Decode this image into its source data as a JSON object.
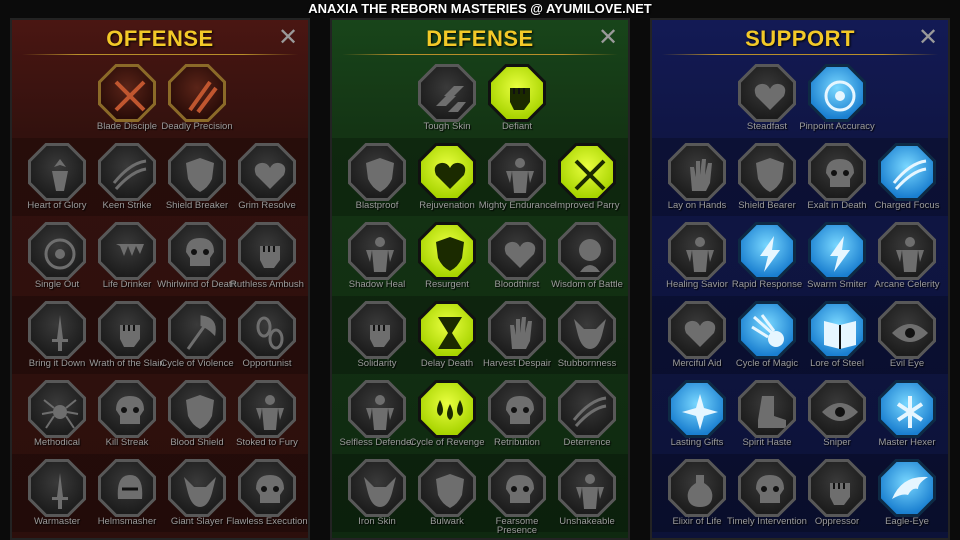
{
  "banner": "ANAXIA THE REBORN MASTERIES @ AYUMILOVE.NET",
  "close_glyph": "✕",
  "panels": [
    {
      "title": "OFFENSE",
      "tier1": [
        {
          "label": "Blade Disciple",
          "icon": "crossed-blades-icon",
          "active": true
        },
        {
          "label": "Deadly Precision",
          "icon": "daggers-icon",
          "active": true
        }
      ],
      "rows": [
        [
          {
            "label": "Heart of Glory",
            "icon": "warrior-icon",
            "active": false
          },
          {
            "label": "Keen Strike",
            "icon": "slash-icon",
            "active": false
          },
          {
            "label": "Shield Breaker",
            "icon": "shield-icon",
            "active": false
          },
          {
            "label": "Grim Resolve",
            "icon": "heart-icon",
            "active": false
          }
        ],
        [
          {
            "label": "Single Out",
            "icon": "target-icon",
            "active": false
          },
          {
            "label": "Life Drinker",
            "icon": "fangs-icon",
            "active": false
          },
          {
            "label": "Whirlwind of Death",
            "icon": "skull-icon",
            "active": false
          },
          {
            "label": "Ruthless Ambush",
            "icon": "fist-icon",
            "active": false
          }
        ],
        [
          {
            "label": "Bring it Down",
            "icon": "sword-icon",
            "active": false
          },
          {
            "label": "Wrath of the Slain",
            "icon": "fist-icon",
            "active": false
          },
          {
            "label": "Cycle of Violence",
            "icon": "axe-icon",
            "active": false
          },
          {
            "label": "Opportunist",
            "icon": "chain-icon",
            "active": false
          }
        ],
        [
          {
            "label": "Methodical",
            "icon": "spider-icon",
            "active": false
          },
          {
            "label": "Kill Streak",
            "icon": "skull-icon",
            "active": false
          },
          {
            "label": "Blood Shield",
            "icon": "shield-icon",
            "active": false
          },
          {
            "label": "Stoked to Fury",
            "icon": "figure-icon",
            "active": false
          }
        ],
        [
          {
            "label": "Warmaster",
            "icon": "sword-icon",
            "active": false
          },
          {
            "label": "Helmsmasher",
            "icon": "helmet-icon",
            "active": false
          },
          {
            "label": "Giant Slayer",
            "icon": "beast-icon",
            "active": false
          },
          {
            "label": "Flawless Execution",
            "icon": "skull-icon",
            "active": false
          }
        ]
      ]
    },
    {
      "title": "DEFENSE",
      "tier1": [
        {
          "label": "Tough Skin",
          "icon": "scales-icon",
          "active": false
        },
        {
          "label": "Defiant",
          "icon": "fist-icon",
          "active": true
        }
      ],
      "rows": [
        [
          {
            "label": "Blastproof",
            "icon": "shield-icon",
            "active": false
          },
          {
            "label": "Rejuvenation",
            "icon": "heart-icon",
            "active": true
          },
          {
            "label": "Mighty Endurance",
            "icon": "figure-icon",
            "active": false
          },
          {
            "label": "Improved Parry",
            "icon": "crossed-blades-icon",
            "active": true
          }
        ],
        [
          {
            "label": "Shadow Heal",
            "icon": "figure-icon",
            "active": false
          },
          {
            "label": "Resurgent",
            "icon": "shield-icon",
            "active": true
          },
          {
            "label": "Bloodthirst",
            "icon": "heart-icon",
            "active": false
          },
          {
            "label": "Wisdom of Battle",
            "icon": "head-icon",
            "active": false
          }
        ],
        [
          {
            "label": "Solidarity",
            "icon": "fist-icon",
            "active": false
          },
          {
            "label": "Delay Death",
            "icon": "hourglass-icon",
            "active": true
          },
          {
            "label": "Harvest Despair",
            "icon": "hand-icon",
            "active": false
          },
          {
            "label": "Stubbornness",
            "icon": "beast-icon",
            "active": false
          }
        ],
        [
          {
            "label": "Selfless Defender",
            "icon": "figure-icon",
            "active": false
          },
          {
            "label": "Cycle of Revenge",
            "icon": "drops-icon",
            "active": true
          },
          {
            "label": "Retribution",
            "icon": "skull-icon",
            "active": false
          },
          {
            "label": "Deterrence",
            "icon": "slash-icon",
            "active": false
          }
        ],
        [
          {
            "label": "Iron Skin",
            "icon": "beast-icon",
            "active": false
          },
          {
            "label": "Bulwark",
            "icon": "shield-icon",
            "active": false
          },
          {
            "label": "Fearsome Presence",
            "icon": "skull-icon",
            "active": false
          },
          {
            "label": "Unshakeable",
            "icon": "figure-icon",
            "active": false
          }
        ]
      ]
    },
    {
      "title": "SUPPORT",
      "tier1": [
        {
          "label": "Steadfast",
          "icon": "heart-icon",
          "active": false
        },
        {
          "label": "Pinpoint Accuracy",
          "icon": "target-icon",
          "active": true
        }
      ],
      "rows": [
        [
          {
            "label": "Lay on Hands",
            "icon": "hand-icon",
            "active": false
          },
          {
            "label": "Shield Bearer",
            "icon": "shield-icon",
            "active": false
          },
          {
            "label": "Exalt in Death",
            "icon": "skull-icon",
            "active": false
          },
          {
            "label": "Charged Focus",
            "icon": "slash-icon",
            "active": true
          }
        ],
        [
          {
            "label": "Healing Savior",
            "icon": "figure-icon",
            "active": false
          },
          {
            "label": "Rapid Response",
            "icon": "lightning-icon",
            "active": true
          },
          {
            "label": "Swarm Smiter",
            "icon": "lightning-icon",
            "active": true
          },
          {
            "label": "Arcane Celerity",
            "icon": "figure-icon",
            "active": false
          }
        ],
        [
          {
            "label": "Merciful Aid",
            "icon": "heart-icon",
            "active": false
          },
          {
            "label": "Cycle of Magic",
            "icon": "comet-icon",
            "active": true
          },
          {
            "label": "Lore of Steel",
            "icon": "book-icon",
            "active": true
          },
          {
            "label": "Evil Eye",
            "icon": "eye-icon",
            "active": false
          }
        ],
        [
          {
            "label": "Lasting Gifts",
            "icon": "star-icon",
            "active": true
          },
          {
            "label": "Spirit Haste",
            "icon": "boot-icon",
            "active": false
          },
          {
            "label": "Sniper",
            "icon": "eye-icon",
            "active": false
          },
          {
            "label": "Master Hexer",
            "icon": "rune-icon",
            "active": true
          }
        ],
        [
          {
            "label": "Elixir of Life",
            "icon": "potion-icon",
            "active": false
          },
          {
            "label": "Timely Intervention",
            "icon": "skull-icon",
            "active": false
          },
          {
            "label": "Oppressor",
            "icon": "fist-icon",
            "active": false
          },
          {
            "label": "Eagle-Eye",
            "icon": "eagle-icon",
            "active": true
          }
        ]
      ]
    }
  ]
}
